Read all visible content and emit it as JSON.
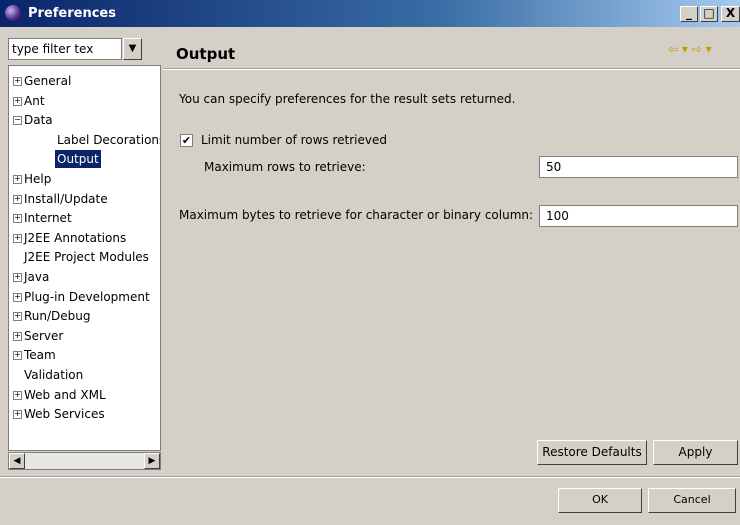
{
  "window": {
    "title": "Preferences",
    "minimize": "_",
    "maximize": "□",
    "close": "X"
  },
  "filter": {
    "value": "type filter tex",
    "dropdown_icon": "chevron-down-icon",
    "dropdown_glyph": "▼"
  },
  "tree": {
    "items": [
      {
        "label": "General",
        "expander": "+"
      },
      {
        "label": "Ant",
        "expander": "+"
      },
      {
        "label": "Data",
        "expander": "−"
      },
      {
        "label": "Label Decorations",
        "expander": ""
      },
      {
        "label": "Output",
        "expander": "",
        "selected": true
      },
      {
        "label": "Help",
        "expander": "+"
      },
      {
        "label": "Install/Update",
        "expander": "+"
      },
      {
        "label": "Internet",
        "expander": "+"
      },
      {
        "label": "J2EE Annotations",
        "expander": "+"
      },
      {
        "label": "J2EE Project Modules",
        "expander": ""
      },
      {
        "label": "Java",
        "expander": "+"
      },
      {
        "label": "Plug-in Development",
        "expander": "+"
      },
      {
        "label": "Run/Debug",
        "expander": "+"
      },
      {
        "label": "Server",
        "expander": "+"
      },
      {
        "label": "Team",
        "expander": "+"
      },
      {
        "label": "Validation",
        "expander": ""
      },
      {
        "label": "Web and XML",
        "expander": "+"
      },
      {
        "label": "Web Services",
        "expander": "+"
      }
    ]
  },
  "scrollbar": {
    "left_glyph": "◀",
    "right_glyph": "▶"
  },
  "page": {
    "title": "Output",
    "nav_glyphs": "⇦ ▾ ⇨ ▾",
    "description": "You can specify preferences for the result sets returned.",
    "limit_rows_label": "Limit number of rows retrieved",
    "limit_rows_checked": "✔",
    "max_rows_label": "Maximum rows to retrieve:",
    "max_rows_value": "50",
    "max_bytes_label": "Maximum bytes to retrieve for character or binary column:",
    "max_bytes_value": "100"
  },
  "buttons": {
    "restore_defaults": "Restore Defaults",
    "apply": "Apply",
    "ok": "OK",
    "cancel": "Cancel"
  },
  "colors": {
    "selection": "#0a246a",
    "titlebar_start": "#0a246a",
    "titlebar_end": "#a6caf0"
  }
}
